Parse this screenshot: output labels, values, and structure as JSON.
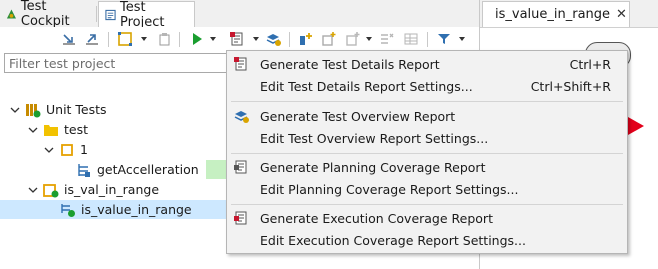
{
  "left_tabs": [
    {
      "label": "Test Cockpit"
    },
    {
      "label": "Test Project"
    }
  ],
  "filter": {
    "placeholder": "Filter test project"
  },
  "tree": {
    "unit_tests": "Unit Tests",
    "test_folder": "test",
    "item_1": "1",
    "get_accel": "getAccelleration",
    "is_val_in_range": "is_val_in_range",
    "is_value_in_range": "is_value_in_range"
  },
  "right_tab": {
    "label": "is_value_in_range"
  },
  "menu": {
    "items": [
      {
        "label": "Generate Test Details Report",
        "accel": "Ctrl+R"
      },
      {
        "label": "Edit Test Details Report Settings...",
        "accel": "Ctrl+Shift+R"
      },
      {
        "label": "Generate Test Overview Report",
        "accel": ""
      },
      {
        "label": "Edit Test Overview Report Settings...",
        "accel": ""
      },
      {
        "label": "Generate Planning Coverage Report",
        "accel": ""
      },
      {
        "label": "Edit Planning Coverage Report Settings...",
        "accel": ""
      },
      {
        "label": "Generate Execution Coverage Report",
        "accel": ""
      },
      {
        "label": "Edit Execution Coverage Report Settings...",
        "accel": ""
      }
    ]
  },
  "colors": {
    "accent_selection": "#cde8ff",
    "run_green": "#1a9e2f",
    "arrow_red": "#e3001b"
  }
}
